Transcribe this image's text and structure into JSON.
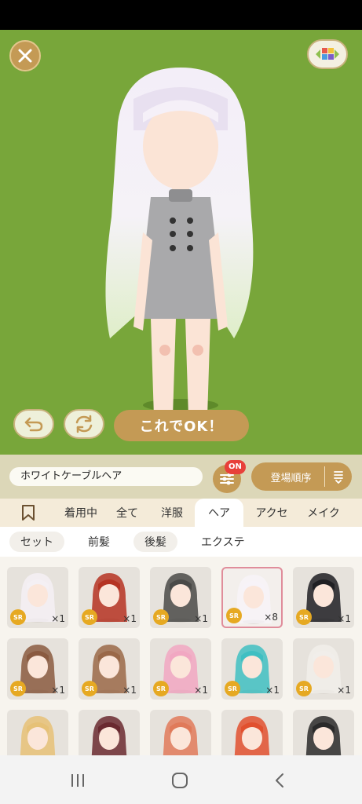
{
  "header": {
    "ok_label": "これでOK！"
  },
  "control": {
    "item_name": "ホワイトケーブルヘア",
    "filter_badge": "ON",
    "sort_label": "登場順序"
  },
  "tabs": [
    {
      "label": ""
    },
    {
      "label": "着用中"
    },
    {
      "label": "全て"
    },
    {
      "label": "洋服"
    },
    {
      "label": "ヘア"
    },
    {
      "label": "アクセ"
    },
    {
      "label": "メイク"
    }
  ],
  "subtabs": [
    {
      "label": "セット"
    },
    {
      "label": "前髪"
    },
    {
      "label": "後髪"
    },
    {
      "label": "エクステ"
    }
  ],
  "items": [
    {
      "badge": "SR",
      "count": "×1",
      "hair": "#f4f0f4"
    },
    {
      "badge": "SR",
      "count": "×1",
      "hair": "#b53322"
    },
    {
      "badge": "SR",
      "count": "×1",
      "hair": "#4a4a48"
    },
    {
      "badge": "SR",
      "count": "×8",
      "hair": "#f7f3f8"
    },
    {
      "badge": "SR",
      "count": "×1",
      "hair": "#1f1f23"
    },
    {
      "badge": "SR",
      "count": "×1",
      "hair": "#8a5a40"
    },
    {
      "badge": "SR",
      "count": "×1",
      "hair": "#9a6848"
    },
    {
      "badge": "SR",
      "count": "×1",
      "hair": "#f1a7c2"
    },
    {
      "badge": "SR",
      "count": "×1",
      "hair": "#3fbfc2"
    },
    {
      "badge": "SR",
      "count": "×1",
      "hair": "#f1eeea"
    },
    {
      "badge": "",
      "count": "",
      "hair": "#e6c177"
    },
    {
      "badge": "",
      "count": "",
      "hair": "#6a2a30"
    },
    {
      "badge": "",
      "count": "",
      "hair": "#e07a5a"
    },
    {
      "badge": "",
      "count": "",
      "hair": "#e1502f"
    },
    {
      "badge": "",
      "count": "",
      "hair": "#2a2a2a"
    }
  ],
  "colors": {
    "stage_bg": "#78a63a",
    "accent": "#c49a55",
    "badge_red": "#e8403a",
    "sr_badge": "#e6a922",
    "selected_border": "#e08d9b"
  },
  "icons": {
    "close": "close-icon",
    "palette": "palette-icon",
    "undo": "undo-icon",
    "rotate": "rotate-icon",
    "filter": "filter-sliders-icon",
    "sort": "sort-icon",
    "bookmark": "bookmark-icon",
    "nav_recent": "recent-apps-icon",
    "nav_home": "home-icon",
    "nav_back": "back-icon"
  }
}
